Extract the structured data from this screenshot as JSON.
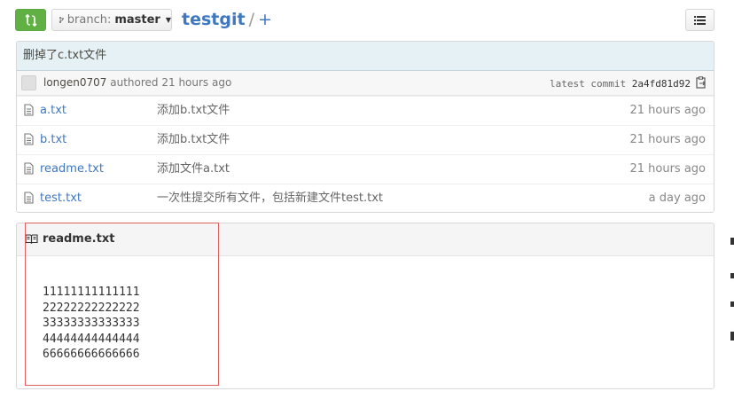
{
  "header": {
    "branch_label": "branch:",
    "branch_name": "master",
    "repo_name": "testgit",
    "separator": "/",
    "plus": "+"
  },
  "commit": {
    "message": "删掉了c.txt文件",
    "author": "longen0707",
    "authored_text": "authored 21 hours ago",
    "latest_label": "latest commit",
    "sha": "2a4fd81d92"
  },
  "files": [
    {
      "name": "a.txt",
      "message": "添加b.txt文件",
      "age": "21 hours ago"
    },
    {
      "name": "b.txt",
      "message": "添加b.txt文件",
      "age": "21 hours ago"
    },
    {
      "name": "readme.txt",
      "message": "添加文件a.txt",
      "age": "21 hours ago"
    },
    {
      "name": "test.txt",
      "message": "一次性提交所有文件，包括新建文件test.txt",
      "age": "a day ago"
    }
  ],
  "readme": {
    "title": "readme.txt",
    "lines": [
      "11111111111111",
      "22222222222222",
      "33333333333333",
      "44444444444444",
      "66666666666666"
    ]
  },
  "colors": {
    "compare_green": "#60b044",
    "link_blue": "#4078c0",
    "commit_bg": "#e6f1f6",
    "highlight_red": "#e06060"
  },
  "icons": {
    "compare": "compare-icon",
    "branch": "branch-icon",
    "list": "list-icon",
    "clipboard": "clipboard-icon",
    "file": "file-icon",
    "book": "book-icon"
  }
}
